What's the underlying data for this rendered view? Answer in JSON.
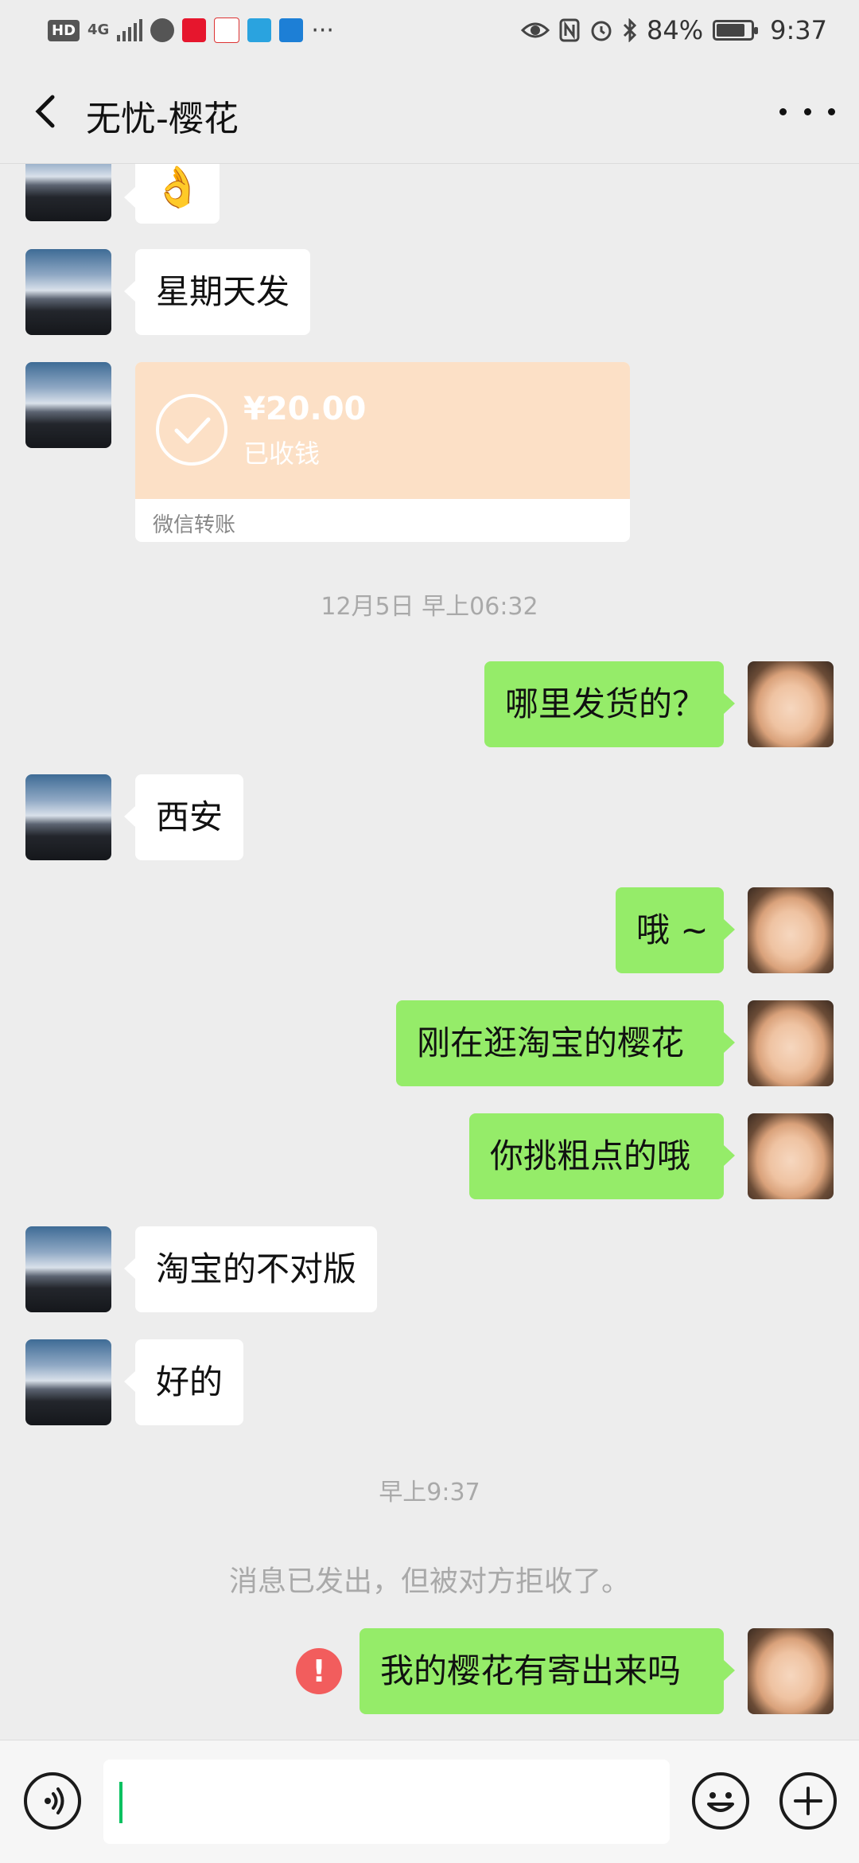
{
  "status_bar": {
    "battery": "84%",
    "battery_level": 0.84,
    "time": "9:37",
    "left_icons": [
      "hd-icon",
      "4g-signal-icon",
      "wechat-icon",
      "weibo-icon",
      "sina-icon",
      "send-app-icon",
      "chat-app-icon",
      "more-notifications-icon"
    ],
    "right_icons": [
      "eye-icon",
      "nfc-icon",
      "alarm-icon",
      "bluetooth-icon",
      "battery-icon"
    ]
  },
  "header": {
    "title": "无忧-樱花"
  },
  "messages": {
    "m1_emoji": "👌",
    "m2": "星期天发",
    "transfer": {
      "amount": "¥20.00",
      "status": "已收钱",
      "footer": "微信转账"
    },
    "ts1": "12月5日 早上06:32",
    "m3": "哪里发货的？",
    "m4": "西安",
    "m5": "哦 ~",
    "m6": "刚在逛淘宝的樱花",
    "m7": "你挑粗点的哦",
    "m8": "淘宝的不对版",
    "m9": "好的",
    "ts2": "早上9:37",
    "system": "消息已发出，但被对方拒收了。",
    "m10": "我的樱花有寄出来吗",
    "error_icon": "!"
  },
  "colors": {
    "background": "#ededed",
    "bubble_sent": "#95ec69",
    "bubble_received": "#ffffff",
    "transfer_card": "#fce0c6",
    "error": "#f25d5d",
    "caret": "#06c160"
  }
}
